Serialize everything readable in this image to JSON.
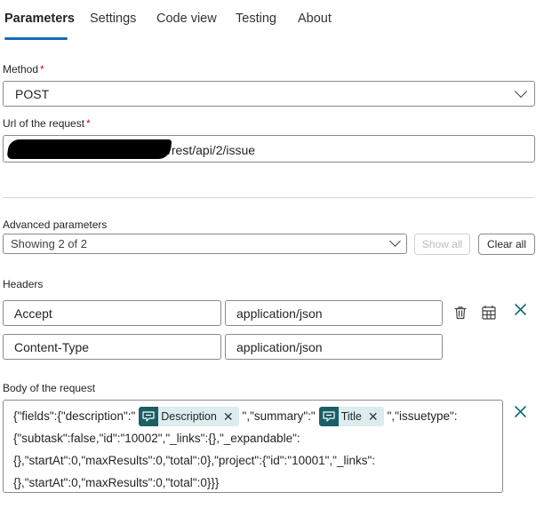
{
  "tabs": [
    {
      "label": "Parameters",
      "active": true
    },
    {
      "label": "Settings"
    },
    {
      "label": "Code view"
    },
    {
      "label": "Testing"
    },
    {
      "label": "About"
    }
  ],
  "method": {
    "label": "Method",
    "required_mark": "*",
    "value": "POST"
  },
  "url": {
    "label": "Url of the request",
    "required_mark": "*",
    "value": "/rest/api/2/issue"
  },
  "advanced": {
    "label": "Advanced parameters",
    "value": "Showing 2 of 2",
    "show_all": "Show all",
    "clear_all": "Clear all"
  },
  "headers": {
    "label": "Headers",
    "rows": [
      {
        "key": "Accept",
        "value": "application/json"
      },
      {
        "key": "Content-Type",
        "value": "application/json"
      }
    ]
  },
  "body": {
    "label": "Body of the request",
    "part1": "{\"fields\":{\"description\":\"",
    "token1": "Description",
    "part2": "\",\"summary\":\"",
    "token2": "Title",
    "part3": "\",\"issuetype\":{\"subtask\":false,\"id\":\"10002\",\"_links\":{},\"_expandable\":{},\"startAt\":0,\"maxResults\":0,\"total\":0},\"project\":{\"id\":\"10001\",\"_links\":{},\"startAt\":0,\"maxResults\":0,\"total\":0}}}"
  },
  "colors": {
    "accent": "#0f6cbd",
    "required": "#c50f1f",
    "token_bg": "#dcecef",
    "token_icon_bg": "#1b5e66"
  },
  "icons": [
    "chevron-down-icon",
    "trash-icon",
    "table-icon",
    "close-icon",
    "dynamic-content-icon"
  ]
}
